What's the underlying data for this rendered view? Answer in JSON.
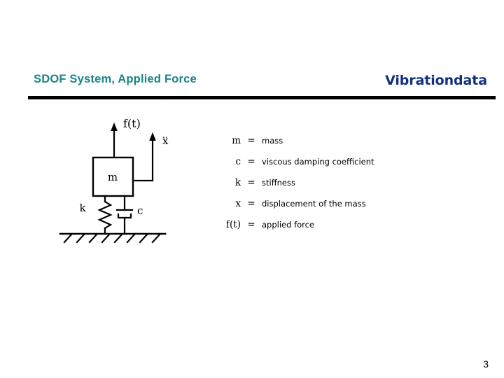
{
  "header": {
    "title": "SDOF System, Applied Force",
    "brand": "Vibrationdata",
    "title_color": "#1a8488",
    "brand_color": "#12307f",
    "rule_color": "#000000"
  },
  "diagram": {
    "name": "sdof-single-degree-of-freedom-schematic",
    "mass_label": "m",
    "spring_label": "k",
    "damper_label": "c",
    "force_label": "f(t)",
    "acceleration_label": "x",
    "acceleration_dots": "..",
    "ground_hatch_count": 8,
    "line_color": "#000000"
  },
  "legend": {
    "rows": [
      {
        "symbol": "m",
        "equals": "=",
        "definition": "mass"
      },
      {
        "symbol": "c",
        "equals": "=",
        "definition": "viscous damping coefficient"
      },
      {
        "symbol": "k",
        "equals": "=",
        "definition": "stiffness"
      },
      {
        "symbol": "x",
        "equals": "=",
        "definition": "displacement of the mass"
      },
      {
        "symbol": "f(t)",
        "equals": "=",
        "definition": "applied force"
      }
    ]
  },
  "footer": {
    "page_number": "3"
  }
}
